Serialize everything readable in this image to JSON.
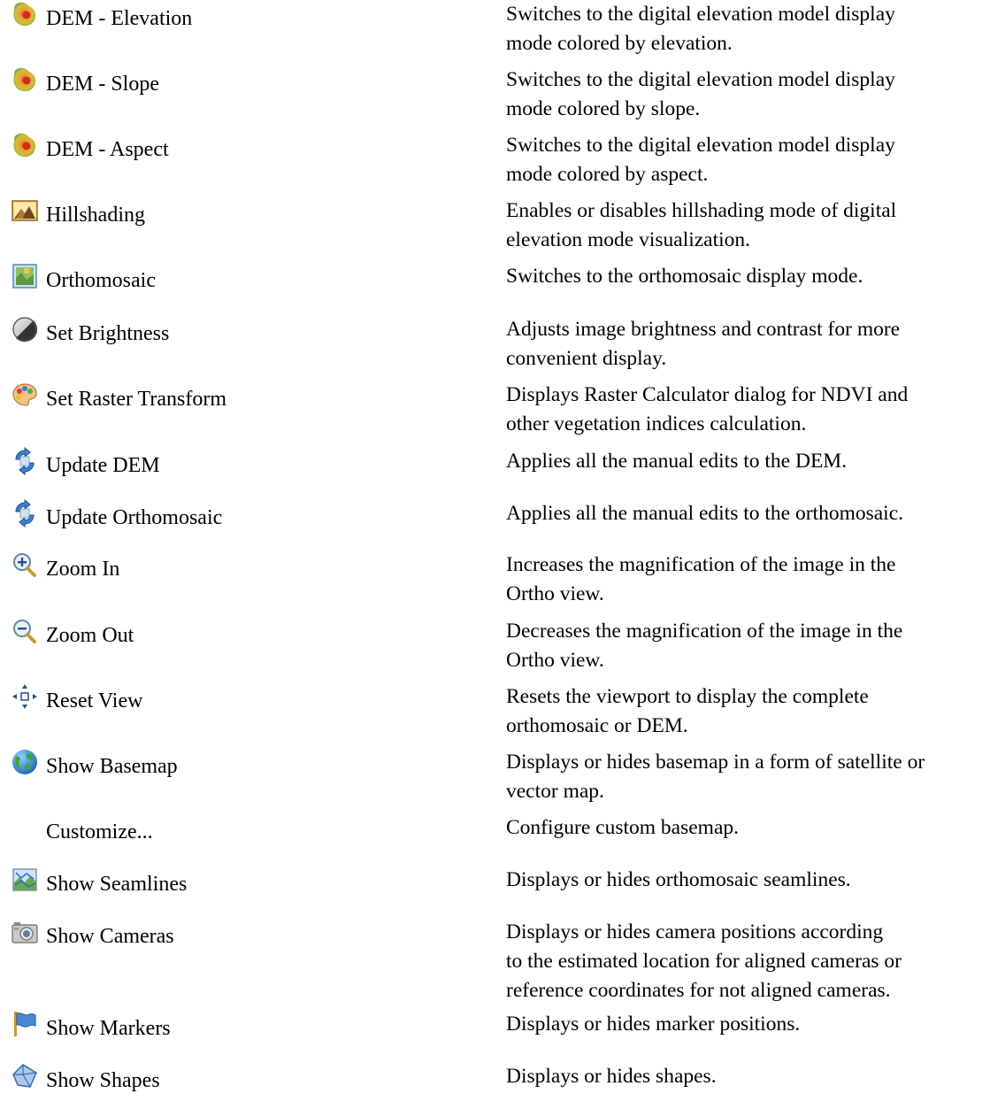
{
  "commands": [
    {
      "label": "DEM - Elevation",
      "icon": "dem-elevation-icon",
      "description": [
        "Switches to the digital elevation model display",
        "mode colored by elevation."
      ]
    },
    {
      "label": "DEM - Slope",
      "icon": "dem-slope-icon",
      "description": [
        "Switches to the digital elevation model display",
        "mode colored by slope."
      ]
    },
    {
      "label": "DEM - Aspect",
      "icon": "dem-aspect-icon",
      "description": [
        "Switches to the digital elevation model display",
        "mode colored by aspect."
      ]
    },
    {
      "label": "Hillshading",
      "icon": "hillshading-icon",
      "description": [
        "Enables or disables hillshading mode of digital",
        "elevation mode visualization."
      ]
    },
    {
      "label": "Orthomosaic",
      "icon": "orthomosaic-icon",
      "description": [
        "Switches to the orthomosaic display mode."
      ]
    },
    {
      "label": "Set Brightness",
      "icon": "brightness-icon",
      "description": [
        "Adjusts image brightness and contrast for more",
        "convenient display."
      ]
    },
    {
      "label": "Set Raster Transform",
      "icon": "palette-icon",
      "description": [
        "Displays Raster Calculator dialog for NDVI and",
        "other vegetation indices calculation."
      ]
    },
    {
      "label": "Update DEM",
      "icon": "refresh-icon",
      "description": [
        "Applies all the manual edits to the DEM."
      ]
    },
    {
      "label": "Update Orthomosaic",
      "icon": "refresh-icon",
      "description": [
        "Applies all the manual edits to the orthomosaic."
      ]
    },
    {
      "label": "Zoom In",
      "icon": "zoom-in-icon",
      "description": [
        "Increases the magnification of the image in the",
        "Ortho view."
      ]
    },
    {
      "label": "Zoom Out",
      "icon": "zoom-out-icon",
      "description": [
        "Decreases the magnification of the image in the",
        "Ortho view."
      ]
    },
    {
      "label": "Reset View",
      "icon": "reset-view-icon",
      "description": [
        "Resets the viewport to display the complete",
        "orthomosaic or DEM."
      ]
    },
    {
      "label": "Show Basemap",
      "icon": "globe-icon",
      "description": [
        "Displays or hides basemap in a form of satellite or",
        "vector map."
      ]
    },
    {
      "label": "Customize...",
      "icon": "",
      "description": [
        "Configure custom basemap."
      ]
    },
    {
      "label": "Show Seamlines",
      "icon": "seamlines-icon",
      "description": [
        "Displays or hides orthomosaic seamlines."
      ]
    },
    {
      "label": "Show Cameras",
      "icon": "camera-icon",
      "description": [
        "Displays or hides camera positions according",
        "to the estimated location for aligned cameras or",
        "reference coordinates for not aligned cameras."
      ]
    },
    {
      "label": "Show Markers",
      "icon": "marker-flag-icon",
      "description": [
        "Displays or hides marker positions."
      ]
    },
    {
      "label": "Show Shapes",
      "icon": "shapes-icon",
      "description": [
        "Displays or hides shapes."
      ]
    }
  ]
}
